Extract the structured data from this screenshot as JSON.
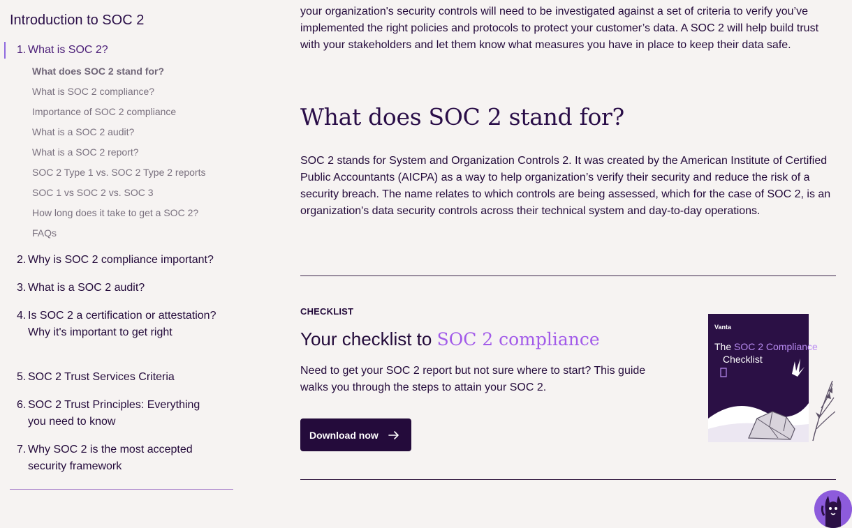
{
  "sidebar": {
    "title": "Introduction to SOC 2",
    "items": [
      {
        "num": "1.",
        "label": "What is SOC 2?"
      },
      {
        "num": "2.",
        "label": "Why is SOC 2 compliance important?"
      },
      {
        "num": "3.",
        "label": "What is a SOC 2 audit?"
      },
      {
        "num": "4.",
        "label": "Is SOC 2 a certification or attestation? Why it's important to get right"
      },
      {
        "num": "5.",
        "label": "SOC 2 Trust Services Criteria"
      },
      {
        "num": "6.",
        "label": "SOC 2 Trust Principles: Everything you need to know"
      },
      {
        "num": "7.",
        "label": "Why SOC 2 is the most accepted security framework"
      }
    ],
    "subitems": [
      "What does SOC 2 stand for?",
      "What is SOC 2 compliance?",
      "Importance of SOC 2 compliance",
      "What is a SOC 2 audit?",
      "What is a SOC 2 report?",
      "SOC 2 Type 1 vs. SOC 2 Type 2 reports",
      "SOC 1 vs SOC 2 vs. SOC 3",
      "How long does it take to get a SOC 2?",
      "FAQs"
    ]
  },
  "main": {
    "intro_paragraph": "your organization's security controls will need to be investigated against a set of criteria to verify you’ve implemented the right policies and protocols to protect your customer’s data. A SOC 2 will help build trust with your stakeholders and let them know what measures you have in place to keep their data safe.",
    "heading": "What does SOC 2 stand for?",
    "body_paragraph": "SOC 2 stands for System and Organization Controls 2. It was created by the American Institute of Certified Public Accountants (AICPA) as a way to help organization’s verify their security and reduce the risk of a security breach. The name relates to which controls are being assessed, which for the case of SOC 2, is an organization's data security controls across their technical system and day-to-day operations."
  },
  "cta": {
    "eyebrow": "CHECKLIST",
    "title_plain": "Your checklist to ",
    "title_accent": "SOC 2 compliance",
    "description": "Need to get your SOC 2 report but not sure where to start? This guide walks you through the steps to attain your SOC 2.",
    "button_label": "Download now",
    "book": {
      "brand": "Vanta",
      "title_prefix": "The ",
      "title_highlight": "SOC 2 Compliance",
      "title_suffix": "Checklist"
    }
  },
  "icons": {
    "button_arrow": "arrow-right-icon",
    "chat_avatar": "llama-mascot-icon"
  },
  "colors": {
    "background": "#f6f3f2",
    "ink": "#240b3b",
    "accent": "#a25be9",
    "button": "#240b3b"
  }
}
